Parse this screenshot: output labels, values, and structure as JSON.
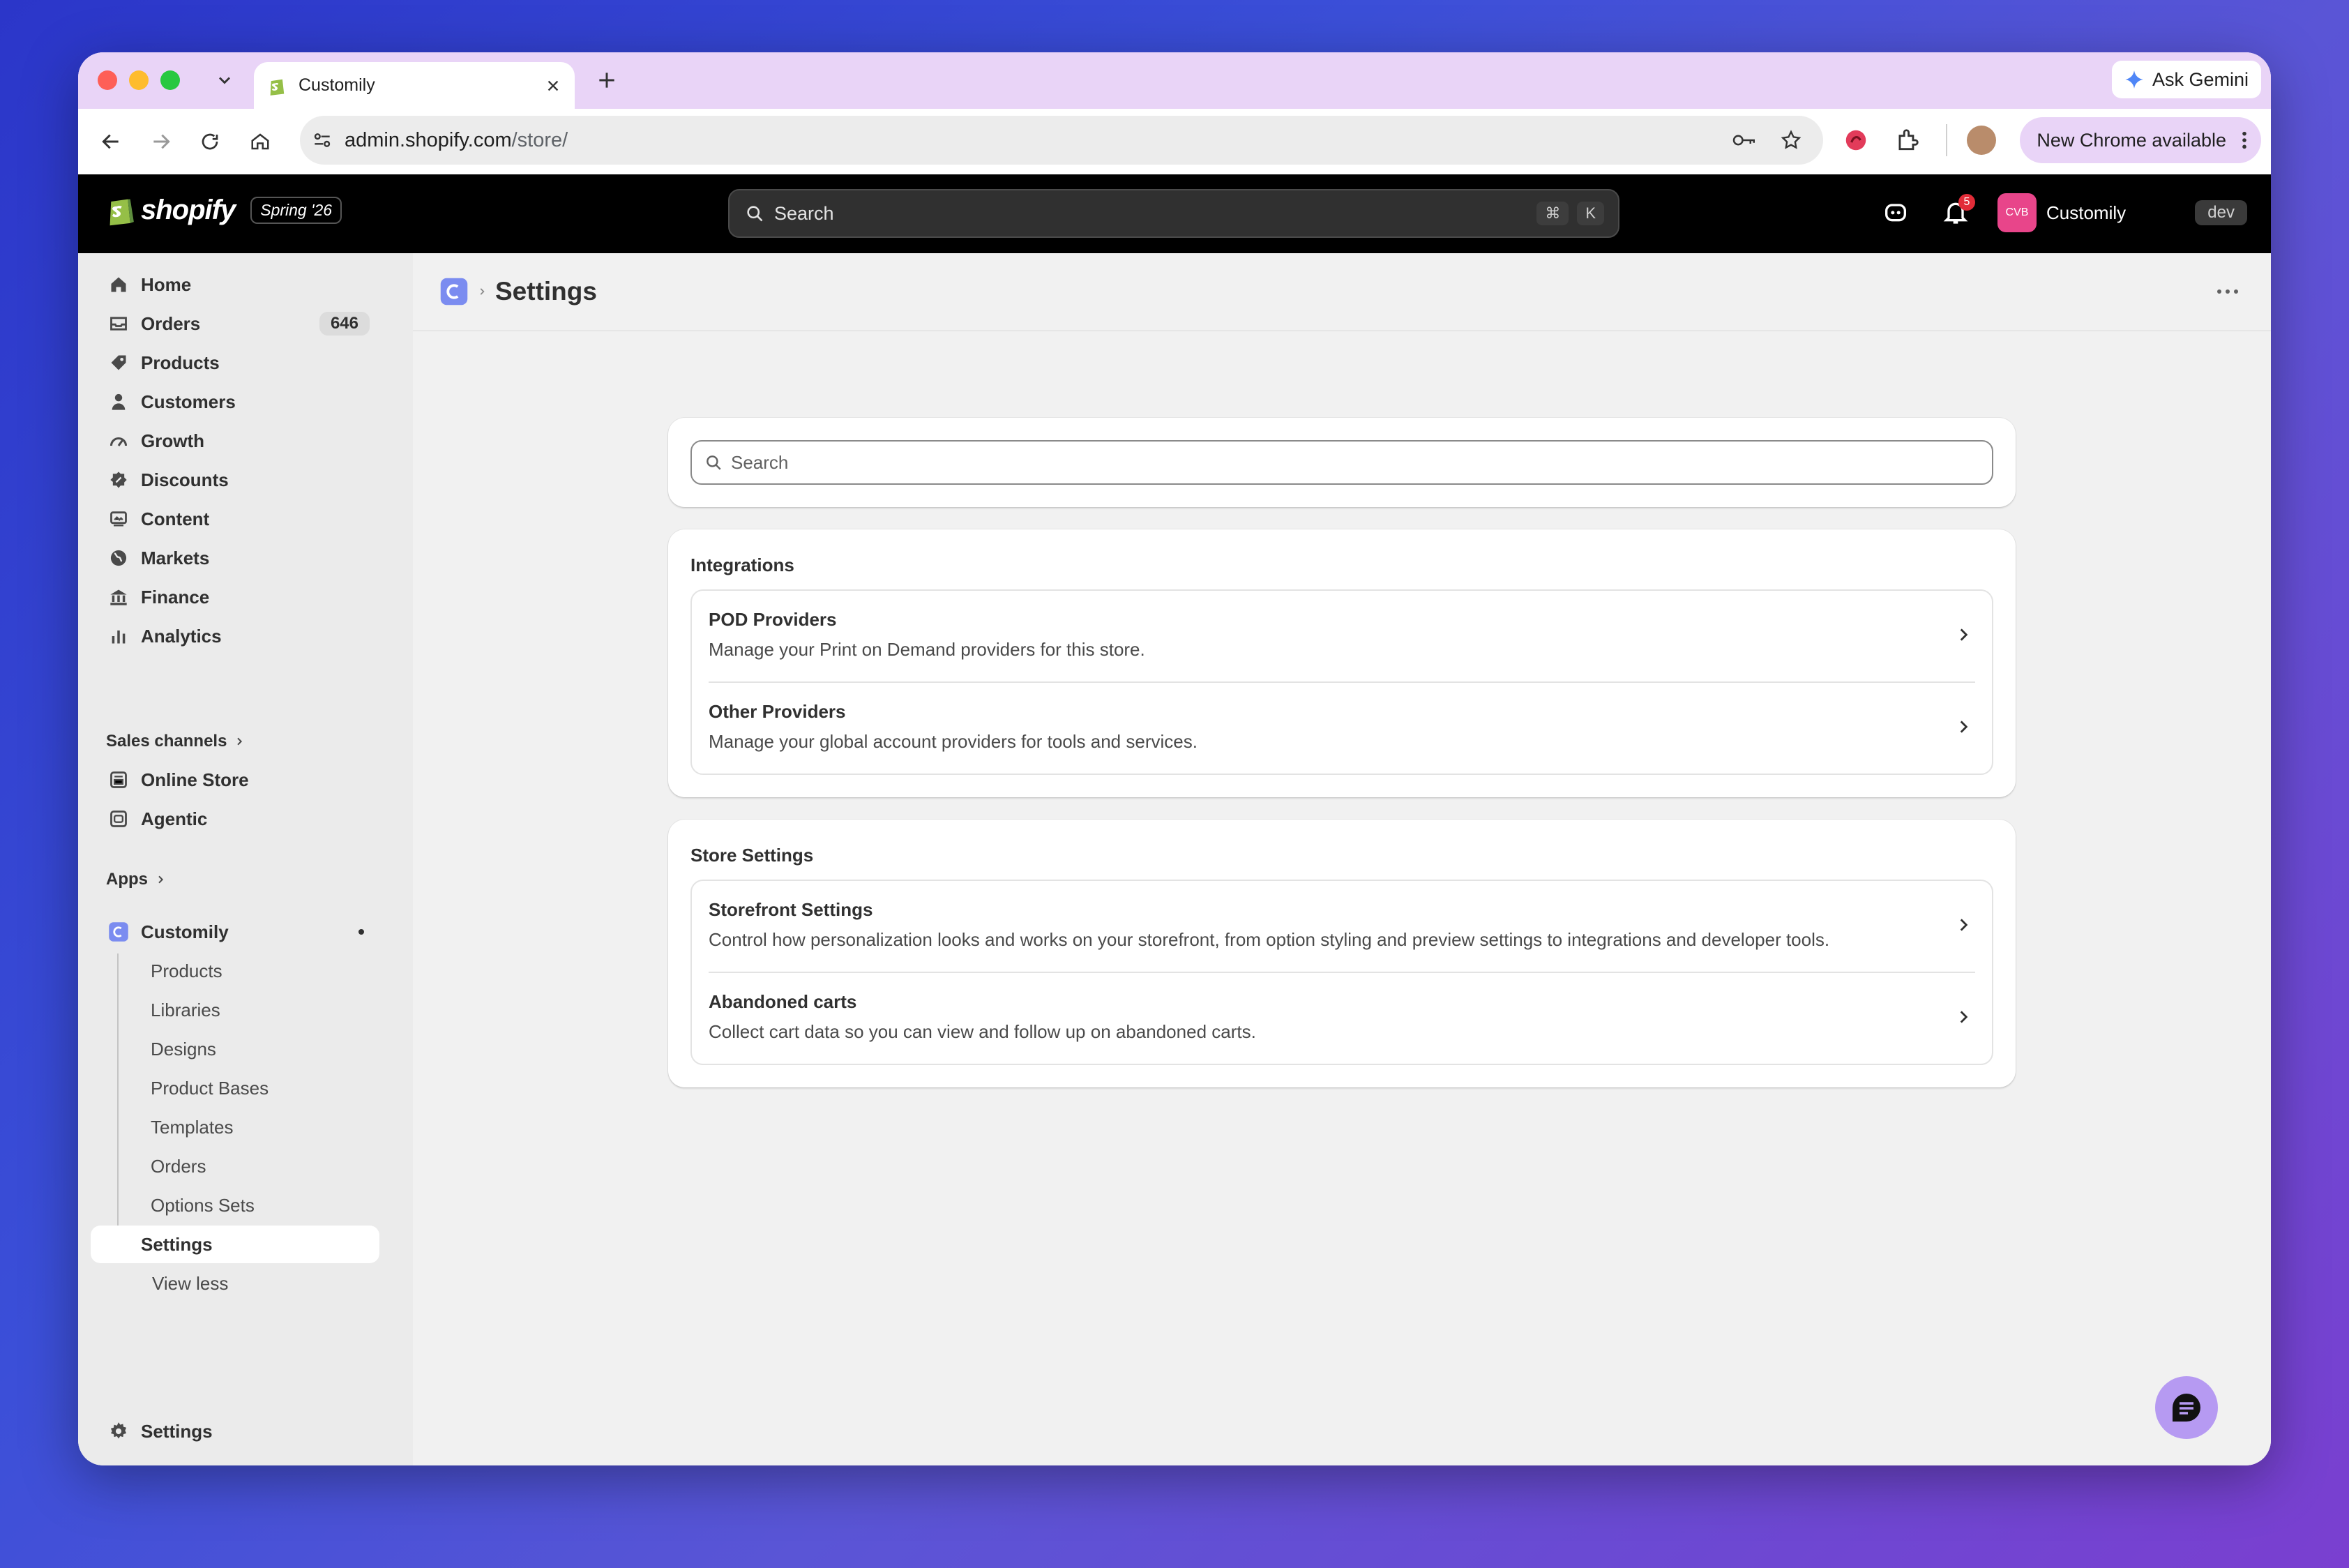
{
  "browser": {
    "tab_title": "Customily",
    "ask_gemini": "Ask Gemini",
    "url_host": "admin.shopify.com",
    "url_path": "/store/",
    "new_chrome": "New Chrome available"
  },
  "topbar": {
    "brand": "shopify",
    "edition": "Spring '26",
    "search_placeholder": "Search",
    "shortcut_cmd": "⌘",
    "shortcut_key": "K",
    "notification_count": "5",
    "store_initials": "CVB",
    "store_name": "Customily",
    "env_badge": "dev"
  },
  "sidebar": {
    "items": [
      {
        "label": "Home",
        "icon": "home-icon"
      },
      {
        "label": "Orders",
        "icon": "inbox-icon",
        "count": "646"
      },
      {
        "label": "Products",
        "icon": "tag-icon"
      },
      {
        "label": "Customers",
        "icon": "person-icon"
      },
      {
        "label": "Growth",
        "icon": "gauge-icon"
      },
      {
        "label": "Discounts",
        "icon": "discount-icon"
      },
      {
        "label": "Content",
        "icon": "content-icon"
      },
      {
        "label": "Markets",
        "icon": "globe-icon"
      },
      {
        "label": "Finance",
        "icon": "bank-icon"
      },
      {
        "label": "Analytics",
        "icon": "bar-chart-icon"
      }
    ],
    "sales_channels_label": "Sales channels",
    "channels": [
      {
        "label": "Online Store",
        "icon": "store-icon"
      },
      {
        "label": "Agentic",
        "icon": "agent-icon"
      }
    ],
    "apps_label": "Apps",
    "app_name": "Customily",
    "app_sub": [
      "Products",
      "Libraries",
      "Designs",
      "Product Bases",
      "Templates",
      "Orders",
      "Options Sets",
      "Settings"
    ],
    "view_less": "View less",
    "settings": "Settings"
  },
  "main": {
    "title": "Settings",
    "search_placeholder": "Search",
    "integrations": {
      "title": "Integrations",
      "rows": [
        {
          "title": "POD Providers",
          "desc": "Manage your Print on Demand providers for this store."
        },
        {
          "title": "Other Providers",
          "desc": "Manage your global account providers for tools and services."
        }
      ]
    },
    "store_settings": {
      "title": "Store Settings",
      "rows": [
        {
          "title": "Storefront Settings",
          "desc": "Control how personalization looks and works on your storefront, from option styling and preview settings to integrations and developer tools."
        },
        {
          "title": "Abandoned carts",
          "desc": "Collect cart data so you can view and follow up on abandoned carts."
        }
      ]
    }
  },
  "colors": {
    "tabstrip": "#e9d4f7",
    "topbar": "#000000",
    "accent_pink": "#e8458a",
    "chat_button": "#b69af2"
  }
}
